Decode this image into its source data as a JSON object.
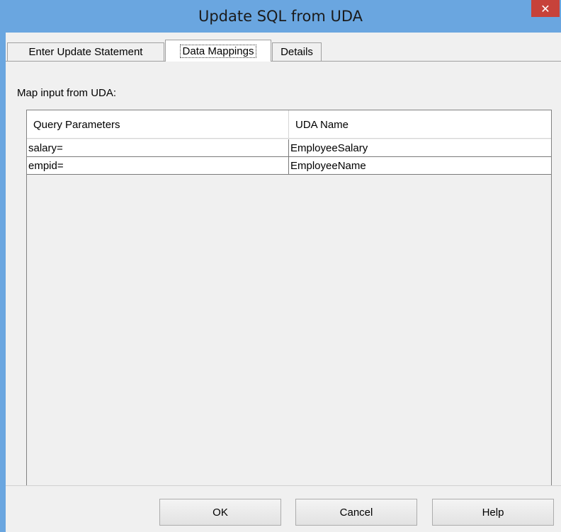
{
  "window": {
    "title": "Update SQL from UDA",
    "close_glyph": "✕"
  },
  "tabs": [
    {
      "label": "Enter Update Statement",
      "active": false
    },
    {
      "label": "Data Mappings",
      "active": true
    },
    {
      "label": "Details",
      "active": false
    }
  ],
  "mapping": {
    "label": "Map input from UDA:",
    "columns": [
      "Query Parameters",
      "UDA Name"
    ],
    "rows": [
      {
        "param": "salary=",
        "uda": "EmployeeSalary"
      },
      {
        "param": "empid=",
        "uda": "EmployeeName"
      }
    ]
  },
  "buttons": {
    "ok": "OK",
    "cancel": "Cancel",
    "help": "Help"
  },
  "colors": {
    "title_bar": "#6aa6e0",
    "close_button": "#c7423a",
    "dialog_background": "#f0f0f0"
  }
}
